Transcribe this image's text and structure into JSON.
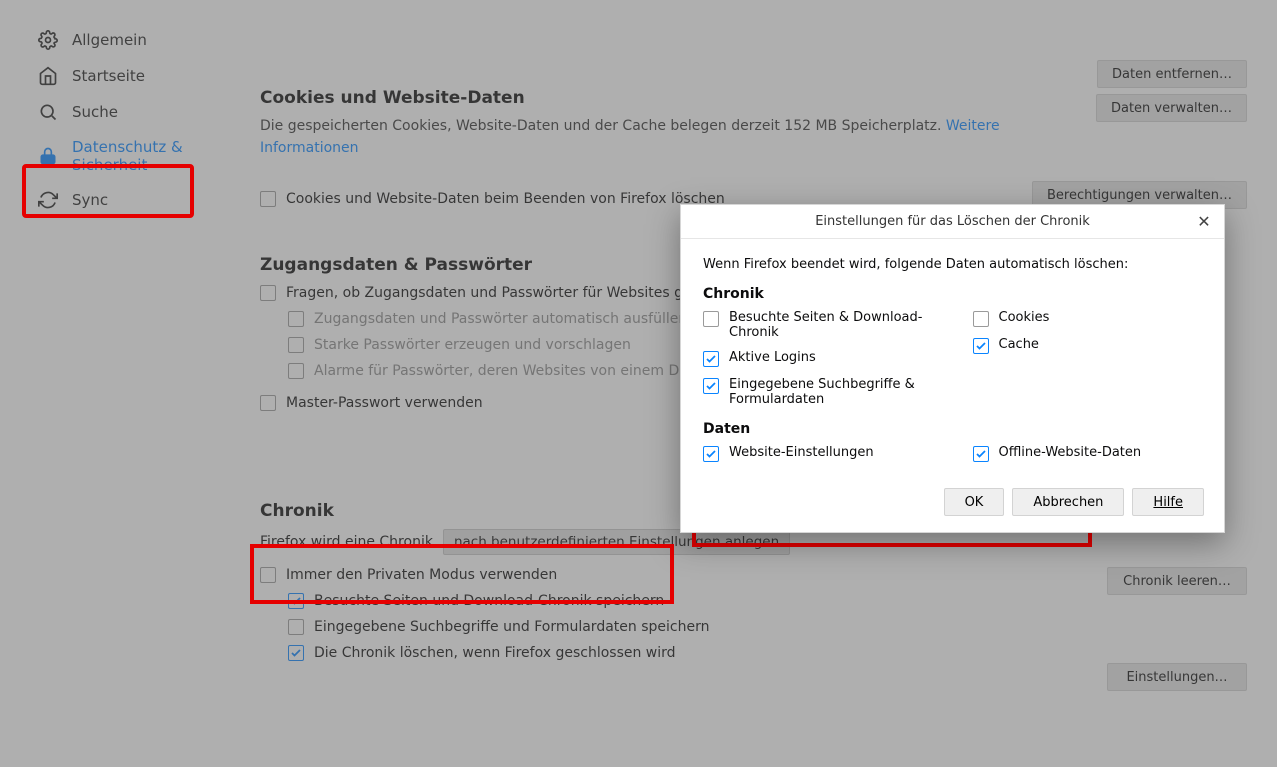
{
  "sidebar": {
    "items": [
      {
        "label": "Allgemein"
      },
      {
        "label": "Startseite"
      },
      {
        "label": "Suche"
      },
      {
        "label": "Datenschutz & Sicherheit"
      },
      {
        "label": "Sync"
      }
    ]
  },
  "cookies": {
    "heading": "Cookies und Website-Daten",
    "desc_a": "Die gespeicherten Cookies, Website-Daten und der Cache belegen derzeit 152 MB Speicherplatz.  ",
    "more": "Weitere Informationen",
    "btn_clear": "Daten entfernen…",
    "btn_manage": "Daten verwalten…",
    "btn_perm": "Berechtigungen verwalten…",
    "opt_delete_on_close": "Cookies und Website-Daten beim Beenden von Firefox löschen"
  },
  "logins": {
    "heading": "Zugangsdaten & Passwörter",
    "ask": "Fragen, ob Zugangsdaten und Passwörter für Websites gespeichert werden sollen",
    "autofill": "Zugangsdaten und Passwörter automatisch ausfüllen",
    "generate": "Starke Passwörter erzeugen und vorschlagen",
    "alerts": "Alarme für Passwörter, deren Websites von einem Datenleck betroffen waren",
    "master": "Master-Passwort verwenden"
  },
  "chronik": {
    "heading": "Chronik",
    "label": "Firefox wird eine Chronik",
    "select": "nach benutzerdefinierten Einstellungen anlegen",
    "private": "Immer den Privaten Modus verwenden",
    "visited": "Besuchte Seiten und Download-Chronik speichern",
    "forms": "Eingegebene Suchbegriffe und Formulardaten speichern",
    "clear_on_close": "Die Chronik löschen, wenn Firefox geschlossen wird",
    "btn_clear": "Chronik leeren…",
    "btn_settings": "Einstellungen…"
  },
  "dialog": {
    "title": "Einstellungen für das Löschen der Chronik",
    "intro": "Wenn Firefox beendet wird, folgende Daten automatisch löschen:",
    "h1": "Chronik",
    "visited": "Besuchte Seiten & Download-Chronik",
    "active": "Aktive Logins",
    "forms": "Eingegebene Suchbegriffe & Formulardaten",
    "cookies": "Cookies",
    "cache": "Cache",
    "h2": "Daten",
    "site": "Website-Einstellungen",
    "offline": "Offline-Website-Daten",
    "ok": "OK",
    "cancel": "Abbrechen",
    "help": "Hilfe"
  }
}
